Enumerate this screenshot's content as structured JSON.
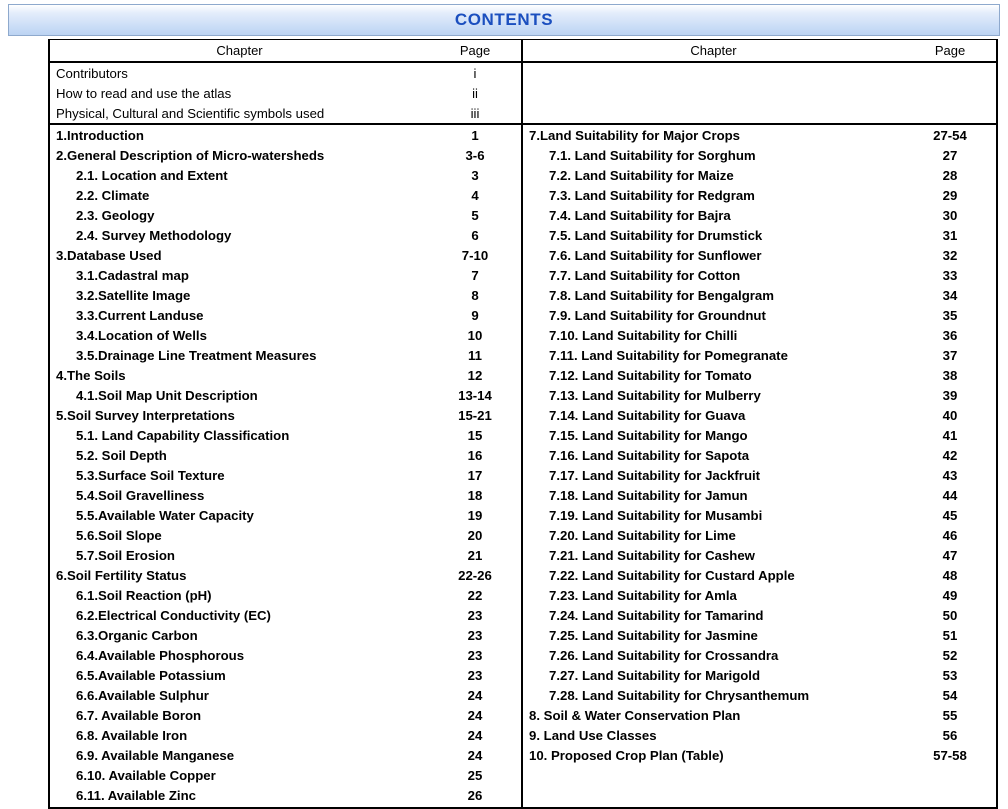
{
  "banner": {
    "title": "CONTENTS",
    "accent_color": "#1b4fbf",
    "background_color": "#c7dbf6",
    "border_color": "#8ea9cd"
  },
  "table": {
    "columns": {
      "chapter_header": "Chapter",
      "page_header": "Page"
    },
    "left": {
      "preamble": [
        {
          "label": "Contributors",
          "page": "i",
          "bold": false,
          "sub": false
        },
        {
          "label": "How to read and use the atlas",
          "page": "ii",
          "bold": false,
          "sub": false
        },
        {
          "label": "Physical, Cultural and Scientific symbols used",
          "page": "iii",
          "bold": false,
          "sub": false
        }
      ],
      "entries": [
        {
          "label": "1.Introduction",
          "page": "1",
          "bold": true,
          "sub": false
        },
        {
          "label": "2.General Description of Micro-watersheds",
          "page": "3-6",
          "bold": true,
          "sub": false
        },
        {
          "label": "2.1. Location and Extent",
          "page": "3",
          "bold": true,
          "sub": true
        },
        {
          "label": "2.2. Climate",
          "page": "4",
          "bold": true,
          "sub": true
        },
        {
          "label": "2.3. Geology",
          "page": "5",
          "bold": true,
          "sub": true
        },
        {
          "label": "2.4. Survey Methodology",
          "page": "6",
          "bold": true,
          "sub": true
        },
        {
          "label": "3.Database Used",
          "page": "7-10",
          "bold": true,
          "sub": false
        },
        {
          "label": "3.1.Cadastral map",
          "page": "7",
          "bold": true,
          "sub": true
        },
        {
          "label": "3.2.Satellite Image",
          "page": "8",
          "bold": true,
          "sub": true
        },
        {
          "label": "3.3.Current Landuse",
          "page": "9",
          "bold": true,
          "sub": true
        },
        {
          "label": "3.4.Location of Wells",
          "page": "10",
          "bold": true,
          "sub": true
        },
        {
          "label": "3.5.Drainage Line Treatment Measures",
          "page": "11",
          "bold": true,
          "sub": true
        },
        {
          "label": "4.The Soils",
          "page": "12",
          "bold": true,
          "sub": false
        },
        {
          "label": "4.1.Soil Map Unit Description",
          "page": "13-14",
          "bold": true,
          "sub": true
        },
        {
          "label": "5.Soil Survey Interpretations",
          "page": "15-21",
          "bold": true,
          "sub": false
        },
        {
          "label": "5.1. Land Capability Classification",
          "page": "15",
          "bold": true,
          "sub": true
        },
        {
          "label": "5.2. Soil Depth",
          "page": "16",
          "bold": true,
          "sub": true
        },
        {
          "label": "5.3.Surface Soil Texture",
          "page": "17",
          "bold": true,
          "sub": true
        },
        {
          "label": "5.4.Soil Gravelliness",
          "page": "18",
          "bold": true,
          "sub": true
        },
        {
          "label": "5.5.Available Water Capacity",
          "page": "19",
          "bold": true,
          "sub": true
        },
        {
          "label": "5.6.Soil Slope",
          "page": "20",
          "bold": true,
          "sub": true
        },
        {
          "label": "5.7.Soil Erosion",
          "page": "21",
          "bold": true,
          "sub": true
        },
        {
          "label": "6.Soil Fertility Status",
          "page": "22-26",
          "bold": true,
          "sub": false
        },
        {
          "label": "6.1.Soil Reaction (pH)",
          "page": "22",
          "bold": true,
          "sub": true
        },
        {
          "label": "6.2.Electrical Conductivity (EC)",
          "page": "23",
          "bold": true,
          "sub": true
        },
        {
          "label": "6.3.Organic Carbon",
          "page": "23",
          "bold": true,
          "sub": true
        },
        {
          "label": "6.4.Available  Phosphorous",
          "page": "23",
          "bold": true,
          "sub": true
        },
        {
          "label": "6.5.Available  Potassium",
          "page": "23",
          "bold": true,
          "sub": true
        },
        {
          "label": "6.6.Available Sulphur",
          "page": "24",
          "bold": true,
          "sub": true
        },
        {
          "label": "6.7. Available Boron",
          "page": "24",
          "bold": true,
          "sub": true
        },
        {
          "label": "6.8. Available Iron",
          "page": "24",
          "bold": true,
          "sub": true
        },
        {
          "label": "6.9. Available Manganese",
          "page": "24",
          "bold": true,
          "sub": true
        },
        {
          "label": "6.10. Available Copper",
          "page": "25",
          "bold": true,
          "sub": true
        },
        {
          "label": "6.11. Available Zinc",
          "page": "26",
          "bold": true,
          "sub": true
        }
      ]
    },
    "right": {
      "preamble": [],
      "entries": [
        {
          "label": "7.Land Suitability for Major Crops",
          "page": "27-54",
          "bold": true,
          "sub": false
        },
        {
          "label": "7.1. Land Suitability for Sorghum",
          "page": "27",
          "bold": true,
          "sub": true
        },
        {
          "label": "7.2. Land Suitability for Maize",
          "page": "28",
          "bold": true,
          "sub": true
        },
        {
          "label": "7.3. Land Suitability for Redgram",
          "page": "29",
          "bold": true,
          "sub": true
        },
        {
          "label": "7.4. Land Suitability for Bajra",
          "page": "30",
          "bold": true,
          "sub": true
        },
        {
          "label": "7.5. Land Suitability for Drumstick",
          "page": "31",
          "bold": true,
          "sub": true
        },
        {
          "label": "7.6. Land Suitability for Sunflower",
          "page": "32",
          "bold": true,
          "sub": true
        },
        {
          "label": "7.7. Land Suitability for Cotton",
          "page": "33",
          "bold": true,
          "sub": true
        },
        {
          "label": "7.8. Land Suitability for Bengalgram",
          "page": "34",
          "bold": true,
          "sub": true
        },
        {
          "label": "7.9. Land Suitability for Groundnut",
          "page": "35",
          "bold": true,
          "sub": true
        },
        {
          "label": "7.10. Land Suitability for Chilli",
          "page": "36",
          "bold": true,
          "sub": true
        },
        {
          "label": "7.11. Land Suitability for Pomegranate",
          "page": "37",
          "bold": true,
          "sub": true
        },
        {
          "label": "7.12. Land Suitability for Tomato",
          "page": "38",
          "bold": true,
          "sub": true
        },
        {
          "label": "7.13. Land Suitability for Mulberry",
          "page": "39",
          "bold": true,
          "sub": true
        },
        {
          "label": "7.14. Land Suitability for Guava",
          "page": "40",
          "bold": true,
          "sub": true
        },
        {
          "label": "7.15. Land Suitability for Mango",
          "page": "41",
          "bold": true,
          "sub": true
        },
        {
          "label": "7.16. Land Suitability for Sapota",
          "page": "42",
          "bold": true,
          "sub": true
        },
        {
          "label": "7.17. Land Suitability for Jackfruit",
          "page": "43",
          "bold": true,
          "sub": true
        },
        {
          "label": "7.18. Land Suitability for Jamun",
          "page": "44",
          "bold": true,
          "sub": true
        },
        {
          "label": "7.19. Land Suitability for Musambi",
          "page": "45",
          "bold": true,
          "sub": true
        },
        {
          "label": "7.20. Land Suitability for Lime",
          "page": "46",
          "bold": true,
          "sub": true
        },
        {
          "label": "7.21. Land Suitability for Cashew",
          "page": "47",
          "bold": true,
          "sub": true
        },
        {
          "label": "7.22. Land Suitability for Custard Apple",
          "page": "48",
          "bold": true,
          "sub": true
        },
        {
          "label": "7.23. Land Suitability for Amla",
          "page": "49",
          "bold": true,
          "sub": true
        },
        {
          "label": "7.24. Land Suitability for Tamarind",
          "page": "50",
          "bold": true,
          "sub": true
        },
        {
          "label": "7.25. Land Suitability for Jasmine",
          "page": "51",
          "bold": true,
          "sub": true
        },
        {
          "label": "7.26. Land Suitability for Crossandra",
          "page": "52",
          "bold": true,
          "sub": true
        },
        {
          "label": "7.27. Land Suitability for Marigold",
          "page": "53",
          "bold": true,
          "sub": true
        },
        {
          "label": "7.28. Land Suitability for Chrysanthemum",
          "page": "54",
          "bold": true,
          "sub": true
        },
        {
          "label": "8. Soil & Water Conservation Plan",
          "page": "55",
          "bold": true,
          "sub": false
        },
        {
          "label": "9. Land Use Classes",
          "page": "56",
          "bold": true,
          "sub": false
        },
        {
          "label": "10. Proposed Crop Plan (Table)",
          "page": "57-58",
          "bold": true,
          "sub": false
        }
      ]
    }
  }
}
